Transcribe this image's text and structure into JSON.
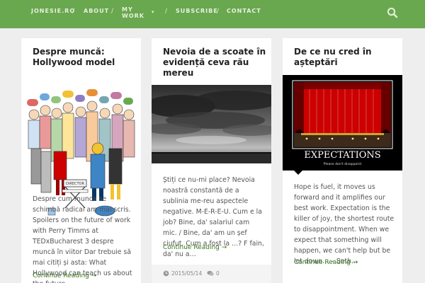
{
  "nav": {
    "site": "JONESIE.RO",
    "about": "ABOUT",
    "mywork": "MY WORK",
    "subscribe": "SUBSCRIBE",
    "contact": "CONTACT",
    "sep": "/",
    "caret": "▾"
  },
  "posts": [
    {
      "title": "Despre muncă: Hollywood model",
      "excerpt": "Despre cum munca se schimbă radical am mai scris. Spoilers on the future of work with Perry Timms at TEDxBucharest 3 despre muncă în viitor Dar trebuie să mai citiți și asta: What Hollywood can teach us about the future…",
      "read_more": "Continue Reading →",
      "image_label": "DIRECTOR"
    },
    {
      "title": "Nevoia de a scoate în evidență ceva rău mereu",
      "excerpt": "Știți ce nu-mi place? Nevoia noastră constantă de a sublinia me-reu aspectele negative. M-E-R-E-U. Cum e la job? Bine, da' salariul cam mic. / Bine, da' am un șef ciufut. Cum a fost la …? F fain, da' nu a…",
      "read_more": "Continue Reading →",
      "date": "2015/05/14",
      "comments": "0"
    },
    {
      "title": "De ce nu cred în așteptări",
      "excerpt": "Hope is fuel, it moves us forward and it amplifies our best work. Expectation is the killer of joy, the shortest route to disappointment. When we expect that something will happen, we can't help but be let down… – Seth…",
      "read_more": "Continue Reading →",
      "image_title": "EXPECTATIONS",
      "image_caption": "Please don't disappoint"
    }
  ],
  "colors": {
    "nav_bg": "#6aa84f",
    "link": "#38761d"
  }
}
